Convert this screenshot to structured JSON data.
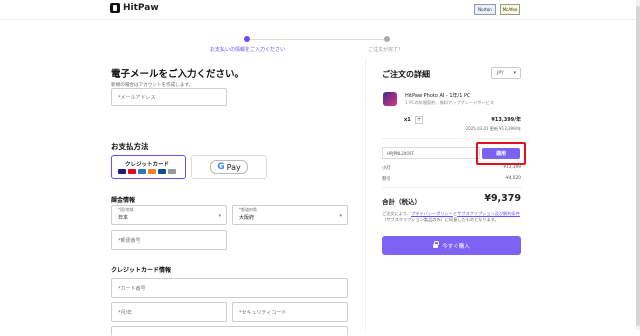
{
  "brand": {
    "name": "HitPaw"
  },
  "badges": [
    "Norton",
    "McAfee"
  ],
  "steps": [
    {
      "label": "お支払いの情報をご入力ください"
    },
    {
      "label": "ご注文が完了！"
    }
  ],
  "email_section": {
    "title": "電子メールをご入力ください。",
    "subtitle": "新規の場合はアカウントを作成します。",
    "email_placeholder": "*メールアドレス"
  },
  "payment": {
    "title": "お支払方法",
    "credit_card_label": "クレジットカード",
    "gpay_label": "Pay"
  },
  "billing": {
    "title": "課金情報",
    "country_label": "*国/地域",
    "country_value": "日本",
    "prefecture_label": "*都道府県",
    "prefecture_value": "大阪府",
    "postal_placeholder": "*郵便番号"
  },
  "card_info": {
    "title": "クレジットカード情報",
    "card_number_placeholder": "*カード番号",
    "expiry_placeholder": "*月/年",
    "cvc_placeholder": "*セキュリティコード"
  },
  "order": {
    "title": "ご注文の詳細",
    "currency": "JPY",
    "product_name": "HitPaw Photo AI - 1年/1 PC",
    "product_sub": "1 PCの年間契約、無料アップグレードサービス",
    "quantity": "x1",
    "plus": "+",
    "price": "¥13,399/年",
    "renewal": "2025.03.01 更新 ¥13,399/年",
    "coupon_code": "HPJPNL20OFF",
    "apply_label": "適用",
    "subtotal_label": "小計",
    "subtotal_value": "¥13,399",
    "discount_label": "割引",
    "discount_value": "-¥4,020",
    "total_label": "合計（税込）",
    "total_value": "¥9,379",
    "terms_prefix": "ご注文により、",
    "terms_link1": "プライバシーポリシー",
    "terms_and": "と",
    "terms_link2": "サブスクリプション及び解約条件",
    "terms_suffix": "（サブスクリプション製品のみ）に同意したものとなります。",
    "buy_label": "今すぐ購入"
  },
  "colors": {
    "accent": "#7c63f3",
    "highlight": "#e0141e"
  }
}
